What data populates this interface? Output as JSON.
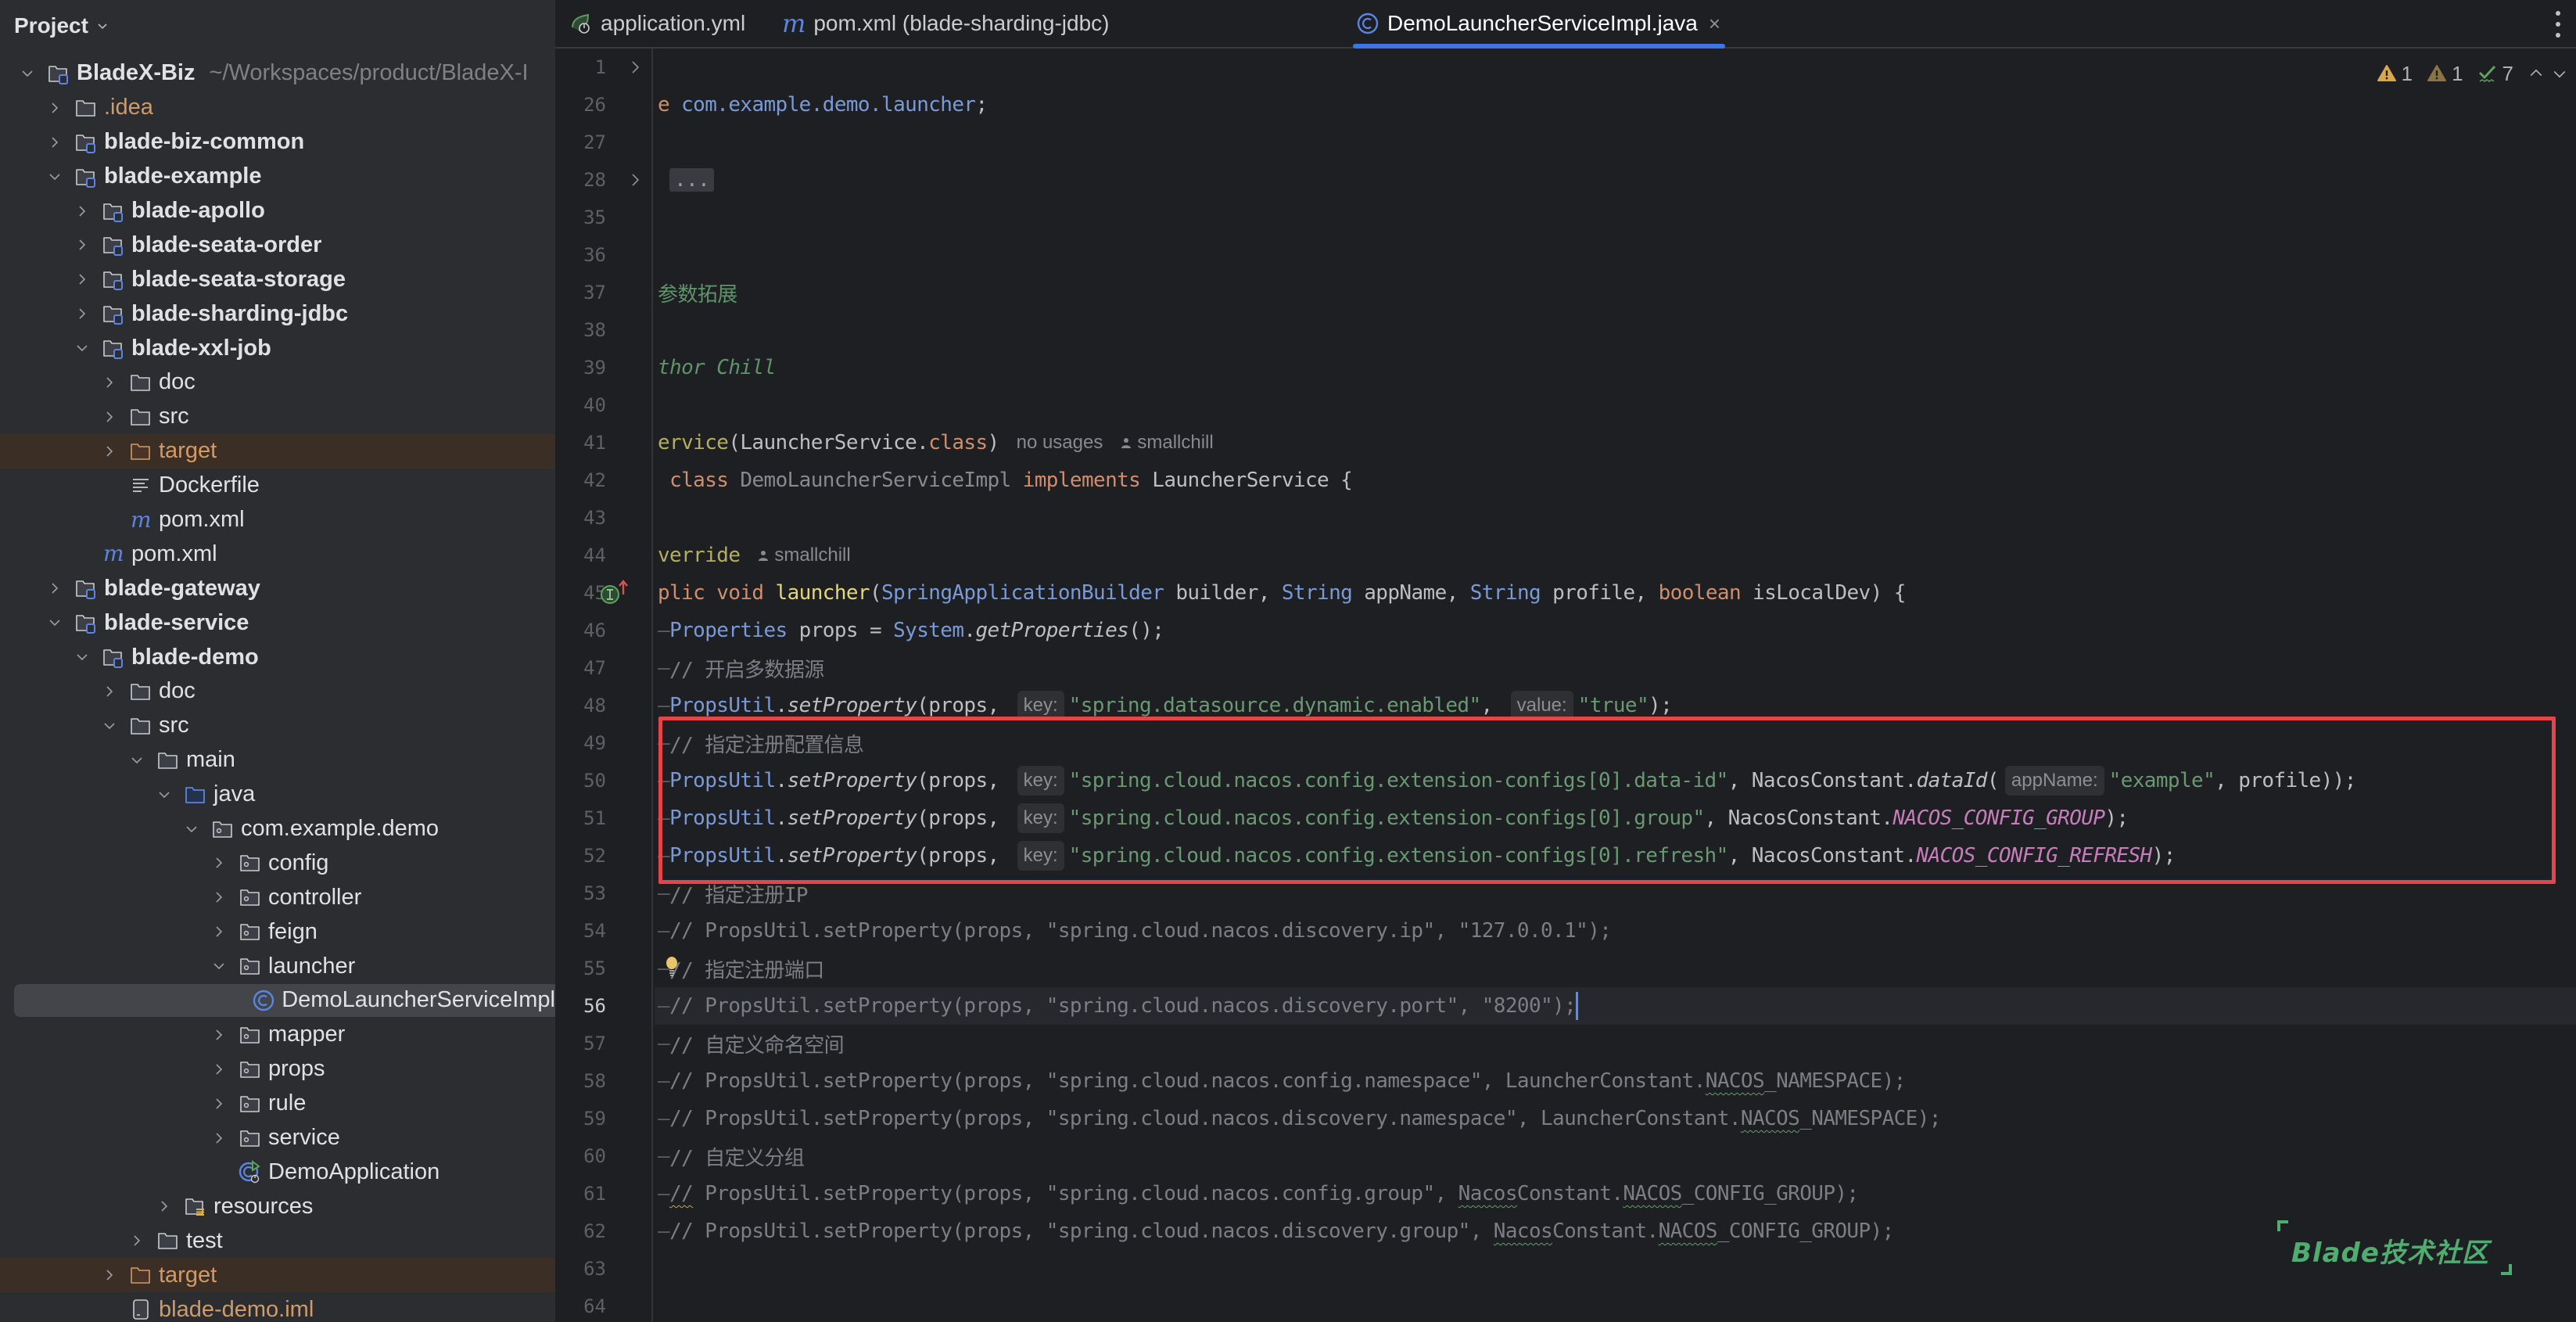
{
  "sidebar": {
    "title": "Project",
    "tree": [
      {
        "label": "BladeX-Biz",
        "path": "~/Workspaces/product/BladeX-I",
        "depth": 0,
        "arrow": "down",
        "icon": "module-folder",
        "bold": true
      },
      {
        "label": ".idea",
        "depth": 1,
        "arrow": "right",
        "icon": "folder",
        "style": "orange"
      },
      {
        "label": "blade-biz-common",
        "depth": 1,
        "arrow": "right",
        "icon": "module-folder",
        "bold": true
      },
      {
        "label": "blade-example",
        "depth": 1,
        "arrow": "down",
        "icon": "module-folder",
        "bold": true
      },
      {
        "label": "blade-apollo",
        "depth": 2,
        "arrow": "right",
        "icon": "module-folder",
        "bold": true
      },
      {
        "label": "blade-seata-order",
        "depth": 2,
        "arrow": "right",
        "icon": "module-folder",
        "bold": true
      },
      {
        "label": "blade-seata-storage",
        "depth": 2,
        "arrow": "right",
        "icon": "module-folder",
        "bold": true
      },
      {
        "label": "blade-sharding-jdbc",
        "depth": 2,
        "arrow": "right",
        "icon": "module-folder",
        "bold": true
      },
      {
        "label": "blade-xxl-job",
        "depth": 2,
        "arrow": "down",
        "icon": "module-folder",
        "bold": true
      },
      {
        "label": "doc",
        "depth": 3,
        "arrow": "right",
        "icon": "folder"
      },
      {
        "label": "src",
        "depth": 3,
        "arrow": "right",
        "icon": "folder"
      },
      {
        "label": "target",
        "depth": 3,
        "arrow": "right",
        "icon": "excluded-folder",
        "style": "orange",
        "excluded": true
      },
      {
        "label": "Dockerfile",
        "depth": 3,
        "arrow": "none",
        "icon": "text-file"
      },
      {
        "label": "pom.xml",
        "depth": 3,
        "arrow": "none",
        "icon": "maven"
      },
      {
        "label": "pom.xml",
        "depth": 2,
        "arrow": "none",
        "icon": "maven"
      },
      {
        "label": "blade-gateway",
        "depth": 1,
        "arrow": "right",
        "icon": "module-folder",
        "bold": true
      },
      {
        "label": "blade-service",
        "depth": 1,
        "arrow": "down",
        "icon": "module-folder",
        "bold": true
      },
      {
        "label": "blade-demo",
        "depth": 2,
        "arrow": "down",
        "icon": "module-folder",
        "bold": true
      },
      {
        "label": "doc",
        "depth": 3,
        "arrow": "right",
        "icon": "folder"
      },
      {
        "label": "src",
        "depth": 3,
        "arrow": "down",
        "icon": "folder"
      },
      {
        "label": "main",
        "depth": 4,
        "arrow": "down",
        "icon": "folder"
      },
      {
        "label": "java",
        "depth": 5,
        "arrow": "down",
        "icon": "source-folder"
      },
      {
        "label": "com.example.demo",
        "depth": 6,
        "arrow": "down",
        "icon": "package"
      },
      {
        "label": "config",
        "depth": 7,
        "arrow": "right",
        "icon": "package"
      },
      {
        "label": "controller",
        "depth": 7,
        "arrow": "right",
        "icon": "package"
      },
      {
        "label": "feign",
        "depth": 7,
        "arrow": "right",
        "icon": "package"
      },
      {
        "label": "launcher",
        "depth": 7,
        "arrow": "down",
        "icon": "package"
      },
      {
        "label": "DemoLauncherServiceImpl",
        "depth": 8,
        "arrow": "none",
        "icon": "java-class",
        "selected": true
      },
      {
        "label": "mapper",
        "depth": 7,
        "arrow": "right",
        "icon": "package"
      },
      {
        "label": "props",
        "depth": 7,
        "arrow": "right",
        "icon": "package"
      },
      {
        "label": "rule",
        "depth": 7,
        "arrow": "right",
        "icon": "package"
      },
      {
        "label": "service",
        "depth": 7,
        "arrow": "right",
        "icon": "package"
      },
      {
        "label": "DemoApplication",
        "depth": 7,
        "arrow": "none",
        "icon": "spring-boot-class"
      },
      {
        "label": "resources",
        "depth": 5,
        "arrow": "right",
        "icon": "resources-folder"
      },
      {
        "label": "test",
        "depth": 4,
        "arrow": "right",
        "icon": "folder"
      },
      {
        "label": "target",
        "depth": 3,
        "arrow": "right",
        "icon": "excluded-folder",
        "style": "orange",
        "excluded": true
      },
      {
        "label": "blade-demo.iml",
        "depth": 3,
        "arrow": "none",
        "icon": "iml-file",
        "style": "orange"
      }
    ]
  },
  "tabs": [
    {
      "label": "application.yml",
      "icon": "spring-yaml",
      "active": false
    },
    {
      "label": "pom.xml (blade-sharding-jdbc)",
      "icon": "maven",
      "active": false
    },
    {
      "label": "DemoLauncherServiceImpl.java",
      "icon": "java-class",
      "active": true,
      "close": "×"
    }
  ],
  "inspections": {
    "warnings": "1",
    "weak_warnings": "1",
    "typos": "7"
  },
  "editor": {
    "current_line": 56,
    "lines": [
      {
        "n": "1",
        "fold": true,
        "tokens": []
      },
      {
        "n": "26",
        "tokens": [
          [
            "kw",
            "e"
          ],
          [
            "plain",
            " "
          ],
          [
            "pkg",
            "com.example.demo.launcher"
          ],
          [
            "plain",
            ";"
          ]
        ]
      },
      {
        "n": "27",
        "tokens": []
      },
      {
        "n": "28",
        "fold": true,
        "tokens": [
          [
            "plain",
            " "
          ],
          [
            "folded",
            "..."
          ]
        ]
      },
      {
        "n": "35",
        "tokens": []
      },
      {
        "n": "36",
        "tokens": []
      },
      {
        "n": "37",
        "tokens": [
          [
            "doc",
            "参数拓展"
          ]
        ]
      },
      {
        "n": "38",
        "tokens": []
      },
      {
        "n": "39",
        "tokens": [
          [
            "doc-i",
            "thor Chill"
          ]
        ]
      },
      {
        "n": "40",
        "tokens": []
      },
      {
        "n": "41",
        "tokens": [
          [
            "ann",
            "ervice"
          ],
          [
            "plain",
            "(LauncherService."
          ],
          [
            "kw",
            "class"
          ],
          [
            "plain",
            ")"
          ],
          [
            "meta",
            "no usages"
          ],
          [
            "author",
            "smallchill"
          ]
        ]
      },
      {
        "n": "42",
        "tokens": [
          [
            "plain",
            " "
          ],
          [
            "kw",
            "class"
          ],
          [
            "plain",
            " "
          ],
          [
            "unused",
            "DemoLauncherServiceImpl"
          ],
          [
            "plain",
            " "
          ],
          [
            "kw",
            "implements"
          ],
          [
            "plain",
            " LauncherService {"
          ]
        ]
      },
      {
        "n": "43",
        "tokens": []
      },
      {
        "n": "44",
        "tokens": [
          [
            "ann",
            "verride"
          ],
          [
            "author",
            "smallchill"
          ]
        ]
      },
      {
        "n": "45",
        "icon": "implements-method",
        "tokens": [
          [
            "kw",
            "plic void "
          ],
          [
            "fn",
            "launcher"
          ],
          [
            "plain",
            "("
          ],
          [
            "type",
            "SpringApplicationBuilder"
          ],
          [
            "plain",
            " builder, "
          ],
          [
            "type",
            "String"
          ],
          [
            "plain",
            " appName, "
          ],
          [
            "type",
            "String"
          ],
          [
            "plain",
            " profile, "
          ],
          [
            "kw",
            "boolean"
          ],
          [
            "plain",
            " isLocalDev) {"
          ]
        ]
      },
      {
        "n": "46",
        "tokens": [
          [
            "indent",
            "—"
          ],
          [
            "type",
            "Properties"
          ],
          [
            "plain",
            " props = "
          ],
          [
            "type",
            "System"
          ],
          [
            "plain",
            "."
          ],
          [
            "italic",
            "getProperties"
          ],
          [
            "plain",
            "();"
          ]
        ]
      },
      {
        "n": "47",
        "tokens": [
          [
            "indent",
            "—"
          ],
          [
            "comment",
            "// 开启多数据源"
          ]
        ]
      },
      {
        "n": "48",
        "tokens": [
          [
            "indent",
            "—"
          ],
          [
            "type",
            "PropsUtil"
          ],
          [
            "plain",
            "."
          ],
          [
            "italic",
            "setProperty"
          ],
          [
            "plain",
            "(props, "
          ],
          [
            "hint",
            "key:"
          ],
          [
            "str",
            "\"spring.datasource.dynamic.enabled\""
          ],
          [
            "plain",
            ", "
          ],
          [
            "hint",
            "value:"
          ],
          [
            "str",
            "\"true\""
          ],
          [
            "plain",
            ");"
          ]
        ]
      },
      {
        "n": "49",
        "tokens": [
          [
            "indent",
            "—"
          ],
          [
            "comment",
            "// 指定注册配置信息"
          ]
        ]
      },
      {
        "n": "50",
        "tokens": [
          [
            "indent",
            "—"
          ],
          [
            "type",
            "PropsUtil"
          ],
          [
            "plain",
            "."
          ],
          [
            "italic",
            "setProperty"
          ],
          [
            "plain",
            "(props, "
          ],
          [
            "hint",
            "key:"
          ],
          [
            "str",
            "\"spring.cloud.nacos.config.extension-configs[0].data-id\""
          ],
          [
            "plain",
            ", NacosConstant."
          ],
          [
            "italic",
            "dataId"
          ],
          [
            "plain",
            "("
          ],
          [
            "hint",
            "appName:"
          ],
          [
            "str",
            "\"example\""
          ],
          [
            "plain",
            ", profile));"
          ]
        ]
      },
      {
        "n": "51",
        "tokens": [
          [
            "indent",
            "—"
          ],
          [
            "type",
            "PropsUtil"
          ],
          [
            "plain",
            "."
          ],
          [
            "italic",
            "setProperty"
          ],
          [
            "plain",
            "(props, "
          ],
          [
            "hint",
            "key:"
          ],
          [
            "str",
            "\"spring.cloud.nacos.config.extension-configs[0].group\""
          ],
          [
            "plain",
            ", NacosConstant."
          ],
          [
            "const",
            "NACOS_CONFIG_GROUP"
          ],
          [
            "plain",
            ");"
          ]
        ]
      },
      {
        "n": "52",
        "tokens": [
          [
            "indent",
            "—"
          ],
          [
            "type",
            "PropsUtil"
          ],
          [
            "plain",
            "."
          ],
          [
            "italic",
            "setProperty"
          ],
          [
            "plain",
            "(props, "
          ],
          [
            "hint",
            "key:"
          ],
          [
            "str",
            "\"spring.cloud.nacos.config.extension-configs[0].refresh\""
          ],
          [
            "plain",
            ", NacosConstant."
          ],
          [
            "const",
            "NACOS_CONFIG_REFRESH"
          ],
          [
            "plain",
            ");"
          ]
        ]
      },
      {
        "n": "53",
        "tokens": [
          [
            "indent",
            "—"
          ],
          [
            "comment",
            "// 指定注册IP"
          ]
        ]
      },
      {
        "n": "54",
        "tokens": [
          [
            "indent",
            "—"
          ],
          [
            "comment",
            "// PropsUtil.setProperty(props, \"spring.cloud.nacos.discovery.ip\", \"127.0.0.1\");"
          ]
        ]
      },
      {
        "n": "55",
        "bulb": true,
        "tokens": [
          [
            "indent",
            "—"
          ],
          [
            "comment",
            "// 指定注册端口"
          ]
        ]
      },
      {
        "n": "56",
        "caret": true,
        "tokens": [
          [
            "indent",
            "—"
          ],
          [
            "comment",
            "// PropsUtil.setProperty(props, \"spring.cloud.nacos.discovery.port\", \"8200\");"
          ]
        ]
      },
      {
        "n": "57",
        "tokens": [
          [
            "indent",
            "—"
          ],
          [
            "comment",
            "// 自定义命名空间"
          ]
        ]
      },
      {
        "n": "58",
        "tokens": [
          [
            "indent",
            "—"
          ],
          [
            "comment",
            "// PropsUtil.setProperty(props, \"spring.cloud.nacos.config.namespace\", LauncherConstant."
          ],
          [
            "comment-sq",
            "NACOS"
          ],
          [
            "comment",
            "_NAMESPACE);"
          ]
        ]
      },
      {
        "n": "59",
        "tokens": [
          [
            "indent",
            "—"
          ],
          [
            "comment",
            "// PropsUtil.setProperty(props, \"spring.cloud.nacos.discovery.namespace\", LauncherConstant."
          ],
          [
            "comment-sq",
            "NACOS"
          ],
          [
            "comment",
            "_NAMESPACE);"
          ]
        ]
      },
      {
        "n": "60",
        "tokens": [
          [
            "indent",
            "—"
          ],
          [
            "comment",
            "// 自定义分组"
          ]
        ]
      },
      {
        "n": "61",
        "tokens": [
          [
            "indent",
            "—"
          ],
          [
            "comment-sqy",
            "//"
          ],
          [
            "comment",
            " PropsUtil.setProperty(props, \"spring.cloud.nacos.config.group\", "
          ],
          [
            "comment-sq",
            "Nacos"
          ],
          [
            "comment",
            "Constant."
          ],
          [
            "comment-sq",
            "NACOS"
          ],
          [
            "comment",
            "_CONFIG_GROUP);"
          ]
        ]
      },
      {
        "n": "62",
        "tokens": [
          [
            "indent",
            "—"
          ],
          [
            "comment",
            "// PropsUtil.setProperty(props, \"spring.cloud.nacos.discovery.group\", "
          ],
          [
            "comment-sq",
            "Nacos"
          ],
          [
            "comment",
            "Constant."
          ],
          [
            "comment-sq",
            "NACOS"
          ],
          [
            "comment",
            "_CONFIG_GROUP);"
          ]
        ]
      },
      {
        "n": "63",
        "tokens": []
      },
      {
        "n": "64",
        "tokens": []
      }
    ]
  },
  "watermark": {
    "text": "Blade技术社区"
  },
  "colors": {
    "accent": "#3d74e8",
    "highlight_box": "#e5444b",
    "watermark": "#4fae6f",
    "excluded_bg": "#3b2f25"
  }
}
